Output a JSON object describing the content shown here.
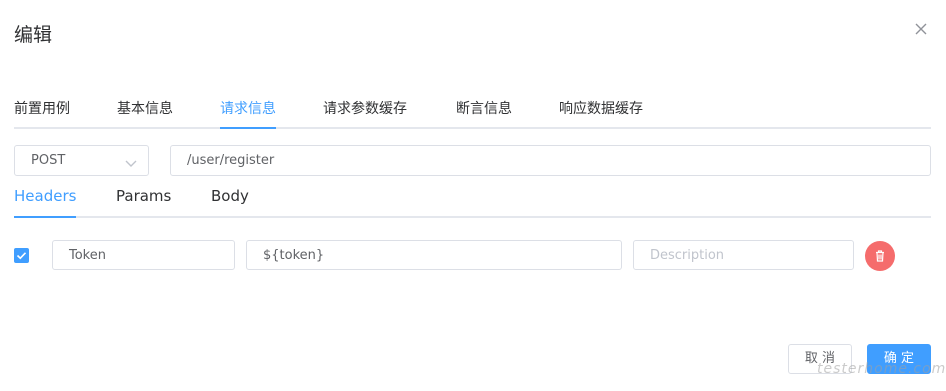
{
  "dialog": {
    "title": "编辑"
  },
  "tabs_top": [
    {
      "label": "前置用例",
      "active": false
    },
    {
      "label": "基本信息",
      "active": false
    },
    {
      "label": "请求信息",
      "active": true
    },
    {
      "label": "请求参数缓存",
      "active": false
    },
    {
      "label": "断言信息",
      "active": false
    },
    {
      "label": "响应数据缓存",
      "active": false
    }
  ],
  "request": {
    "method": "POST",
    "url": "/user/register"
  },
  "sub_tabs": [
    {
      "label": "Headers",
      "active": true
    },
    {
      "label": "Params",
      "active": false
    },
    {
      "label": "Body",
      "active": false
    }
  ],
  "header_row": {
    "checked": true,
    "key": "Token",
    "value": "${token}",
    "description_placeholder": "Description"
  },
  "footer": {
    "cancel_label": "取 消",
    "ok_label": "确 定"
  },
  "watermark": "testerhome.com",
  "colors": {
    "accent": "#409eff",
    "danger": "#f56c6c",
    "border": "#dcdfe6"
  },
  "icons": {
    "close": "close-icon",
    "select_arrow": "chevron-down-icon",
    "checkbox": "check-icon",
    "delete": "trash-icon"
  }
}
